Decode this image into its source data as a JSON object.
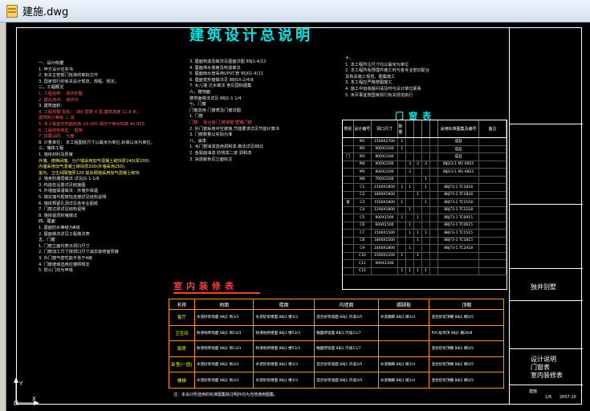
{
  "window": {
    "title": "建施.dwg"
  },
  "drawing": {
    "title": "建筑设计总说明",
    "col1": [
      {
        "t": "一、设计依据",
        "c": "h"
      },
      {
        "t": "  1. 甲方设计任务书",
        "c": ""
      },
      {
        "t": "  2. 有关主管部门批准的审批文件",
        "c": ""
      },
      {
        "t": "  3. 国家现行的有关设计规范、规程、规定。",
        "c": ""
      },
      {
        "t": "二、工程概况",
        "c": "h"
      },
      {
        "t": "  1. 工程名称：  独井别墅",
        "c": "u"
      },
      {
        "t": "  2. 建设地点：  独井村",
        "c": "u"
      },
      {
        "t": "  3. 建筑面积：",
        "c": ""
      },
      {
        "t": "  4. 工程规模 及标：  380  层数 4  层,建筑高度 11.8 米,",
        "c": "u"
      },
      {
        "t": "     建筑耐火等级  二 级",
        "c": "u"
      },
      {
        "t": "  5. 本工程室内地面标高 ±0.000 相当于绝对标高  40.050",
        "c": "u"
      },
      {
        "t": "  6. 工程结构类型：  框架",
        "c": "u"
      },
      {
        "t": "  7. 抗震设防：  七度",
        "c": "u"
      },
      {
        "t": "  8. 计量单位：  本工程图纸尺寸以毫米为单位,标高以米为单位。",
        "c": ""
      },
      {
        "t": "三、墙体工程",
        "c": "h"
      },
      {
        "t": "  1. 墙体材料及厚度",
        "c": ""
      },
      {
        "t": "     外墙、楼梯间墙、分户墙采用加气混凝土砌块厚240(厚200)",
        "c": "y"
      },
      {
        "t": "     内墙采用加气混凝土砌块厚200(外墙采用250),",
        "c": "y"
      },
      {
        "t": "     室内、卫生间隔墙厚120 其余隔墙采用加气混凝土砌块",
        "c": "y"
      },
      {
        "t": "  2. 墙身防潮层做法  详见JG 1-1/6",
        "c": ""
      },
      {
        "t": "  3. 构造柱设置详见结施图",
        "c": ""
      },
      {
        "t": "  4. 外墙面保温做法：外墙外保温",
        "c": ""
      },
      {
        "t": "  5. 填充墙与框架柱连接详见结构说明",
        "c": ""
      },
      {
        "t": "  6. 墙体预留孔洞详见各专业图纸",
        "c": ""
      },
      {
        "t": "  7. 门窗过梁详见结构说明",
        "c": ""
      },
      {
        "t": "  8. 墙体留洞封堵做法",
        "c": ""
      },
      {
        "t": "四、屋面",
        "c": "h"
      },
      {
        "t": "  1. 屋面防水等级为Ⅲ级",
        "c": ""
      },
      {
        "t": "  2. 屋面做法详见工程做法表",
        "c": ""
      },
      {
        "t": "五、门窗",
        "c": "h"
      },
      {
        "t": "  1. 门窗立面均表示洞口尺寸",
        "c": ""
      },
      {
        "t": "  2. 门窗加工尺寸按洞口尺寸减去装修面厚度",
        "c": ""
      },
      {
        "t": "  3. 外门窗气密性能不低于4级",
        "c": ""
      },
      {
        "t": "  4. 门窗玻璃选用应遵照规定",
        "c": ""
      },
      {
        "t": "  5. 防火门均为甲级",
        "c": ""
      }
    ],
    "col2": [
      {
        "t": "3. 屋面构造及做法见屋面详图 89J1-4/12",
        "c": ""
      },
      {
        "t": "4. 屋面排水坡度及构造做法",
        "c": ""
      },
      {
        "t": "5. 屋面雨水管采用UPVC管 95J01-4/11",
        "c": ""
      },
      {
        "t": "6. 屋面变形缝做法见 88J5X-2/4/8",
        "c": ""
      },
      {
        "t": "7. 女儿墙 泛水做法 参见国标图集",
        "c": ""
      },
      {
        "t": "六、楼地面",
        "c": "h"
      },
      {
        "t": "  楼地面做法详见 88J1-1 1/4",
        "c": ""
      },
      {
        "t": "七、门窗",
        "c": "h"
      },
      {
        "t": "  门窗选用 门窗表及门窗详图",
        "c": ""
      },
      {
        "t": "  1. 门窗",
        "c": ""
      },
      {
        "t": "     门窗： 铝合金门,玻璃窗  塑钢门窗",
        "c": "u"
      },
      {
        "t": "  2. 外门窗采用中空玻璃,节能要求详见节能计算书",
        "c": ""
      },
      {
        "t": "  3. 门窗数量以实际为准",
        "c": ""
      },
      {
        "t": "八、油漆",
        "c": "h"
      },
      {
        "t": "  1. 木门窗油漆选用调和漆,做法详见88J1",
        "c": ""
      },
      {
        "t": "  2. 金属面油漆 防锈漆二道 调和漆",
        "c": ""
      },
      {
        "t": "  3. 油漆颜色见立面标注",
        "c": ""
      }
    ],
    "col3": [
      {
        "t": "十、",
        "c": "h"
      },
      {
        "t": "  1. 本工程所注尺寸均以毫米为单位",
        "c": ""
      },
      {
        "t": "  2. 本工程所有预埋件施工时与各专业密切配合",
        "c": ""
      },
      {
        "t": "     及有关施工规范、图集施工",
        "c": ""
      },
      {
        "t": "  3. 本工程应严格按图施工",
        "c": ""
      },
      {
        "t": "  4. 施工中如有疑问请及时与设计单位联系",
        "c": ""
      },
      {
        "t": "  5. 未尽事宜按国家现行有关规范执行",
        "c": ""
      }
    ],
    "door_window_table": {
      "title": "门窗表",
      "headers": [
        "类别",
        "设计编号",
        "洞口尺寸",
        "数量",
        "",
        "",
        "",
        "",
        "采用标准图集及编号",
        "备注"
      ],
      "rows": [
        [
          "",
          "M1",
          "1500X2700",
          "1",
          "",
          "",
          "",
          "",
          "成品",
          ""
        ],
        [
          "",
          "M2",
          "900X2100",
          "1",
          "",
          "",
          "",
          "",
          "成品",
          ""
        ],
        [
          "门",
          "M3",
          "800X2100",
          "",
          "",
          "",
          "",
          "",
          "成品",
          ""
        ],
        [
          "",
          "M4",
          "900X2100",
          "",
          "3",
          "2",
          "3",
          "",
          "88J13-1 M1-0921",
          ""
        ],
        [
          "",
          "M5",
          "800X2100",
          "",
          "2",
          "",
          "",
          "",
          "88J13-1 M1-0821",
          ""
        ],
        [
          "",
          "M6",
          "700X2100",
          "",
          "",
          "",
          "1",
          "",
          "",
          ""
        ],
        [
          "",
          "C1",
          "2100X1800",
          "1",
          "1",
          "",
          "1",
          "",
          "88J73-1 TC1818",
          ""
        ],
        [
          "",
          "C2",
          "1800X1800",
          "",
          "",
          "1",
          "",
          "",
          "88J73-1 TC1818",
          ""
        ],
        [
          "窗",
          "C3",
          "1500X1800",
          "1",
          "",
          "",
          "1",
          "",
          "88J73-1 TC1518",
          ""
        ],
        [
          "",
          "C4",
          "1200X1800",
          "",
          "1",
          "",
          "",
          "",
          "88J73-1 TC1218",
          ""
        ],
        [
          "",
          "C5",
          "900X1500",
          "1",
          "",
          "1",
          "",
          "",
          "88J73-1 TC0915",
          ""
        ],
        [
          "",
          "C6",
          "600X1500",
          "",
          "1",
          "",
          "",
          "",
          "88J73-1 TC0615",
          ""
        ],
        [
          "",
          "C7",
          "1500X1500",
          "",
          "1",
          "1",
          "1",
          "",
          "88J73-1 TC1515",
          ""
        ],
        [
          "",
          "C8",
          "1800X1500",
          "",
          "",
          "1",
          "",
          "",
          "88J73-1 TC1815",
          ""
        ],
        [
          "",
          "C9",
          "2400X1800",
          "",
          "1",
          "",
          "",
          "",
          "88J73-1 TC2418",
          ""
        ],
        [
          "",
          "C10",
          "1500X1200",
          "1",
          "",
          "1",
          "",
          "",
          "",
          ""
        ],
        [
          "",
          "C11",
          "900X1200",
          "",
          "",
          "",
          "",
          "",
          "",
          ""
        ],
        [
          "",
          "C12",
          "",
          "1",
          "1",
          "1",
          "1",
          "",
          "",
          ""
        ]
      ]
    },
    "finish_table": {
      "title": "室内装修表",
      "headers": [
        "名称",
        "地面",
        "楼面",
        "内墙面",
        "踢脚板",
        "顶棚"
      ],
      "rows": [
        [
          "客厅",
          "水泥砂浆地面 88J1 地3/3",
          "水泥砂浆楼面 88J1 楼3/3",
          "混合砂浆墙面 88J1 内墙3/5",
          "水泥踢脚 88J1 踢1/4",
          "混合砂浆顶棚 88J1 棚3/5"
        ],
        [
          "卫生间",
          "防滑地砖地面 88J1 地53/3",
          "防滑地砖楼面 88J1 楼53/3",
          "釉面砖墙面 88J1 内墙11/7",
          "",
          "PVC板吊顶 88J1 棚29/8"
        ],
        [
          "厨房",
          "防滑地砖地面 88J1 地53/3",
          "防滑地砖楼面 88J1 楼53/3",
          "釉面砖墙面 88J1 内墙11/7",
          "",
          "混合砂浆顶棚 88J1 棚3/5"
        ],
        [
          "卧室(一层)",
          "水泥砂浆地面 88J1 地3/3",
          "水泥砂浆楼面 88J1 楼3/3",
          "混合砂浆墙面 88J1 内墙3/5",
          "水泥踢脚 88J1 踢1/4",
          "混合砂浆顶棚 88J1 棚3/5"
        ],
        [
          "楼梯",
          "水泥砂浆地面 88J1 地3/3",
          "水泥砂浆楼面 88J1 楼3/3",
          "混合砂浆墙面 88J1 内墙3/5",
          "水泥踢脚 88J1 踢1/4",
          "混合砂浆顶棚 88J1 棚3/5"
        ]
      ]
    },
    "footnote": "注：本设计所选用的标准图集除注明外均为当地通用图集。",
    "titleblock": {
      "project": "独井别墅",
      "drawing_name_1": "设计说明",
      "drawing_name_2": "门窗表",
      "drawing_name_3": "室内装修表",
      "sheet": "建施",
      "sheet_no": "1/6",
      "date": "2007.10"
    }
  }
}
